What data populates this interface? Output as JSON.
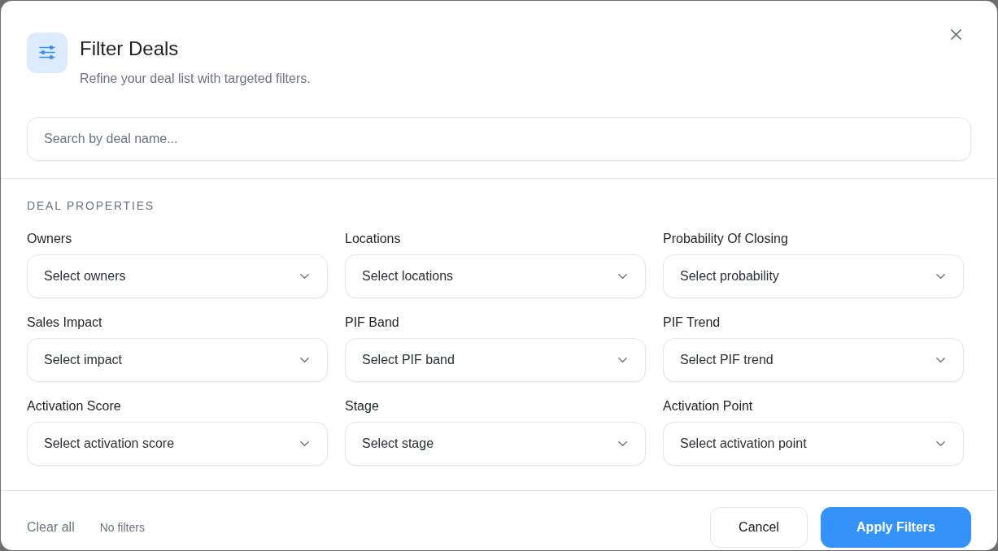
{
  "dialog": {
    "title": "Filter Deals",
    "subtitle": "Refine your deal list with targeted filters."
  },
  "search": {
    "placeholder": "Search by deal name..."
  },
  "section": {
    "heading": "DEAL PROPERTIES",
    "filters": [
      {
        "label": "Owners",
        "placeholder": "Select owners"
      },
      {
        "label": "Locations",
        "placeholder": "Select locations"
      },
      {
        "label": "Probability Of Closing",
        "placeholder": "Select probability"
      },
      {
        "label": "Sales Impact",
        "placeholder": "Select impact"
      },
      {
        "label": "PIF Band",
        "placeholder": "Select PIF band"
      },
      {
        "label": "PIF Trend",
        "placeholder": "Select PIF trend"
      },
      {
        "label": "Activation Score",
        "placeholder": "Select activation score"
      },
      {
        "label": "Stage",
        "placeholder": "Select stage"
      },
      {
        "label": "Activation Point",
        "placeholder": "Select activation point"
      }
    ]
  },
  "footer": {
    "clear_link": "Clear all",
    "status": "No filters",
    "buttons": [
      {
        "label": "Cancel",
        "kind": "secondary"
      },
      {
        "label": "Apply Filters",
        "kind": "primary"
      }
    ]
  }
}
